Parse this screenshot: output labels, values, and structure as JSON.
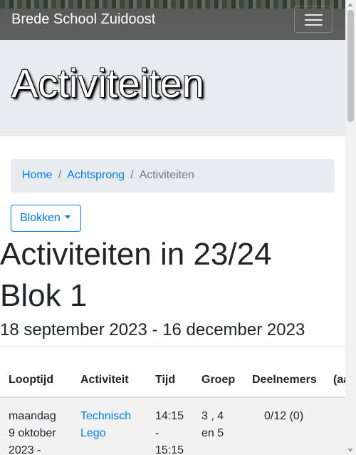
{
  "navbar": {
    "brand": "Brede School Zuidoost",
    "menu_icon": "hamburger-menu-icon"
  },
  "hero": {
    "title": "Activiteiten"
  },
  "breadcrumb": {
    "items": [
      "Home",
      "Achtsprong",
      "Activiteiten"
    ],
    "separator": "/"
  },
  "dropdown": {
    "label": "Blokken"
  },
  "page": {
    "heading_line1": "Activiteiten in 23/24",
    "heading_line2": "Blok 1",
    "date_range": "18 september 2023 - 16 december 2023"
  },
  "table": {
    "columns": [
      "Looptijd",
      "Activiteit",
      "Tijd",
      "Groep",
      "Deelnemers",
      "(aa"
    ],
    "rows": [
      {
        "looptijd": [
          "maandag",
          "9 oktober",
          "2023 -"
        ],
        "activiteit": [
          "Technisch",
          "Lego"
        ],
        "tijd": [
          "14:15",
          "-",
          "15:15"
        ],
        "groep": [
          "3 , 4",
          "en 5"
        ],
        "deelnemers": "0/12 (0)"
      }
    ]
  },
  "colors": {
    "link": "#007bff",
    "hero_bg": "#e9ecef",
    "navbar_bg": "#5e5f5f"
  }
}
